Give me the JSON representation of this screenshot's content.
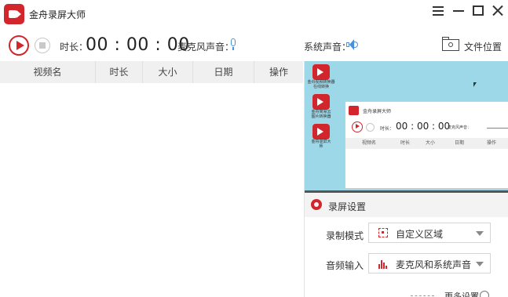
{
  "app": {
    "title": "金舟录屏大师",
    "accent_color": "#d2252c",
    "slider_color": "#4a90d9"
  },
  "window_controls": [
    "menu-icon",
    "minimize-icon",
    "maximize-icon",
    "close-icon"
  ],
  "toolbar": {
    "record_icon": "record-icon",
    "stop_icon": "stop-icon",
    "duration_label": "时长：",
    "timer": "00 : 00 : 00",
    "mic_label": "麦克风声音：",
    "mic_volume_pct": 100,
    "system_label": "系统声音：",
    "system_volume_pct": 100,
    "file_location_label": "文件位置"
  },
  "list": {
    "columns": [
      "视频名",
      "时长",
      "大小",
      "日期",
      "操作"
    ],
    "rows": []
  },
  "preview": {
    "desktop_icons": [
      "金舟视频转换器\n在线转换",
      "金舟简易云\n图片转换器",
      "金舟录屏大\n师"
    ],
    "mini_title": "金舟录屏大师",
    "mini_duration_label": "时长：",
    "mini_timer": "00 : 00 : 00",
    "mini_mic_label": "麦克风声音：",
    "mini_columns": [
      "视频名",
      "时长",
      "大小",
      "日期",
      "操作"
    ]
  },
  "settings": {
    "title": "录屏设置",
    "mode_label": "录制模式",
    "mode_value": "自定义区域",
    "audio_label": "音频输入",
    "audio_value": "麦克风和系统声音",
    "more_label": "更多设置"
  }
}
